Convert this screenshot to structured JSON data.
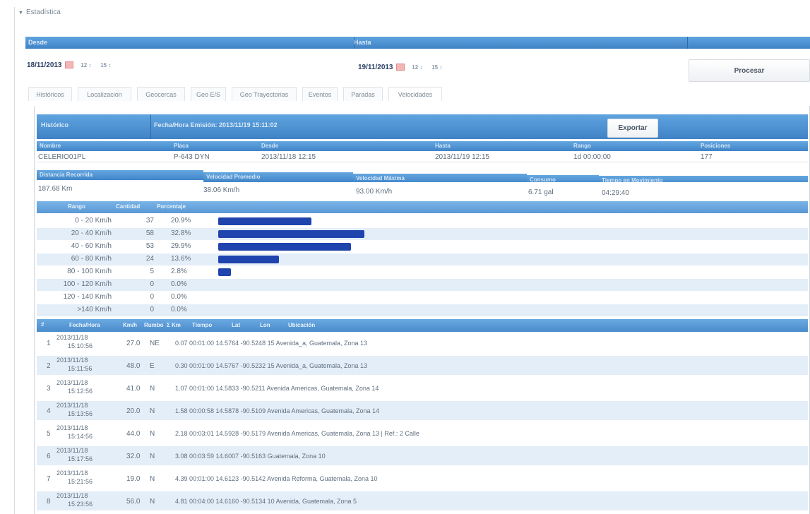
{
  "section": {
    "title": "Estadística"
  },
  "filter": {
    "desde_label": "Desde",
    "hasta_label": "Hasta",
    "from_date": "18/11/2013",
    "from_hour": "12",
    "from_min": "15",
    "to_date": "19/11/2013",
    "to_hour": "12",
    "to_min": "15",
    "process_label": "Procesar"
  },
  "tabs": [
    "Históricos",
    "Localización",
    "Geocercas",
    "Geo E/S",
    "Geo Trayectorias",
    "Eventos",
    "Paradas",
    "Velocidades"
  ],
  "historico": {
    "label": "Histórico",
    "fecha_label": "Fecha/Hora Emisión: 2013/11/19 15:11:02",
    "export_label": "Exportar"
  },
  "vehicle": {
    "headers": [
      "Nombre",
      "Placa",
      "Desde",
      "Hasta",
      "Rango",
      "Posiciones"
    ],
    "values": [
      "CELERIO01PL",
      "P-643 DYN",
      "2013/11/18 12:15",
      "2013/11/19 12:15",
      "1d 00:00:00",
      "177"
    ]
  },
  "summary": {
    "headers": [
      "Distancia Recorrida",
      "Velocidad Promedio",
      "Velocidad Máxima",
      "Consumo",
      "Tiempo en Movimiento"
    ],
    "values": [
      "187.68 Km",
      "38.06 Km/h",
      "93.00 Km/h",
      "6.71 gal",
      "04:29:40"
    ]
  },
  "ranges": {
    "headers": [
      "Rango",
      "Cantidad",
      "Porcentaje"
    ],
    "rows": [
      {
        "range": "0 - 20 Km/h",
        "count": "37",
        "pct": "20.9%",
        "frac": 0.209
      },
      {
        "range": "20 - 40 Km/h",
        "count": "58",
        "pct": "32.8%",
        "frac": 0.328
      },
      {
        "range": "40 - 60 Km/h",
        "count": "53",
        "pct": "29.9%",
        "frac": 0.299
      },
      {
        "range": "60 - 80 Km/h",
        "count": "24",
        "pct": "13.6%",
        "frac": 0.136
      },
      {
        "range": "80 - 100 Km/h",
        "count": "5",
        "pct": "2.8%",
        "frac": 0.028
      },
      {
        "range": "100 - 120 Km/h",
        "count": "0",
        "pct": "0.0%",
        "frac": 0
      },
      {
        "range": "120 - 140 Km/h",
        "count": "0",
        "pct": "0.0%",
        "frac": 0
      },
      {
        "range": ">140 Km/h",
        "count": "0",
        "pct": "0.0%",
        "frac": 0
      }
    ]
  },
  "detail": {
    "headers": [
      "#",
      "Fecha/Hora",
      "Km/h",
      "Rumbo",
      "Σ Km",
      "Tiempo",
      "Lat",
      "Lon",
      "Ubicación"
    ],
    "rows": [
      {
        "n": "1",
        "date": "2013/11/18",
        "time": "15:10:56",
        "speed": "27.0",
        "dir": "NE",
        "rest": "0.07 00:01:00 14.5764 -90.5248 15 Avenida_a, Guatemala, Zona 13"
      },
      {
        "n": "2",
        "date": "2013/11/18",
        "time": "15:11:56",
        "speed": "48.0",
        "dir": "E",
        "rest": "0.30 00:01:00 14.5767 -90.5232 15 Avenida_a, Guatemala, Zona 13"
      },
      {
        "n": "3",
        "date": "2013/11/18",
        "time": "15:12:56",
        "speed": "41.0",
        "dir": "N",
        "rest": "1.07 00:01:00 14.5833 -90.5211 Avenida Americas, Guatemala, Zona 14"
      },
      {
        "n": "4",
        "date": "2013/11/18",
        "time": "15:13:56",
        "speed": "20.0",
        "dir": "N",
        "rest": "1.58 00:00:58 14.5878 -90.5109 Avenida Americas, Guatemala, Zona 14"
      },
      {
        "n": "5",
        "date": "2013/11/18",
        "time": "15:14:56",
        "speed": "44.0",
        "dir": "N",
        "rest": "2.18 00:03:01 14.5928 -90.5179 Avenida Americas, Guatemala, Zona 13 | Ref.: 2 Calle"
      },
      {
        "n": "6",
        "date": "2013/11/18",
        "time": "15:17:56",
        "speed": "32.0",
        "dir": "N",
        "rest": "3.08 00:03:59 14.6007 -90.5163 Guatemala, Zona 10"
      },
      {
        "n": "7",
        "date": "2013/11/18",
        "time": "15:21:56",
        "speed": "19.0",
        "dir": "N",
        "rest": "4.39 00:01:00 14.6123 -90.5142 Avenida Reforma, Guatemala, Zona 10"
      },
      {
        "n": "8",
        "date": "2013/11/18",
        "time": "15:23:56",
        "speed": "56.0",
        "dir": "N",
        "rest": "4.81 00:04:00 14.6160 -90.5134 10 Avenida, Guatemala, Zona 5"
      }
    ]
  }
}
